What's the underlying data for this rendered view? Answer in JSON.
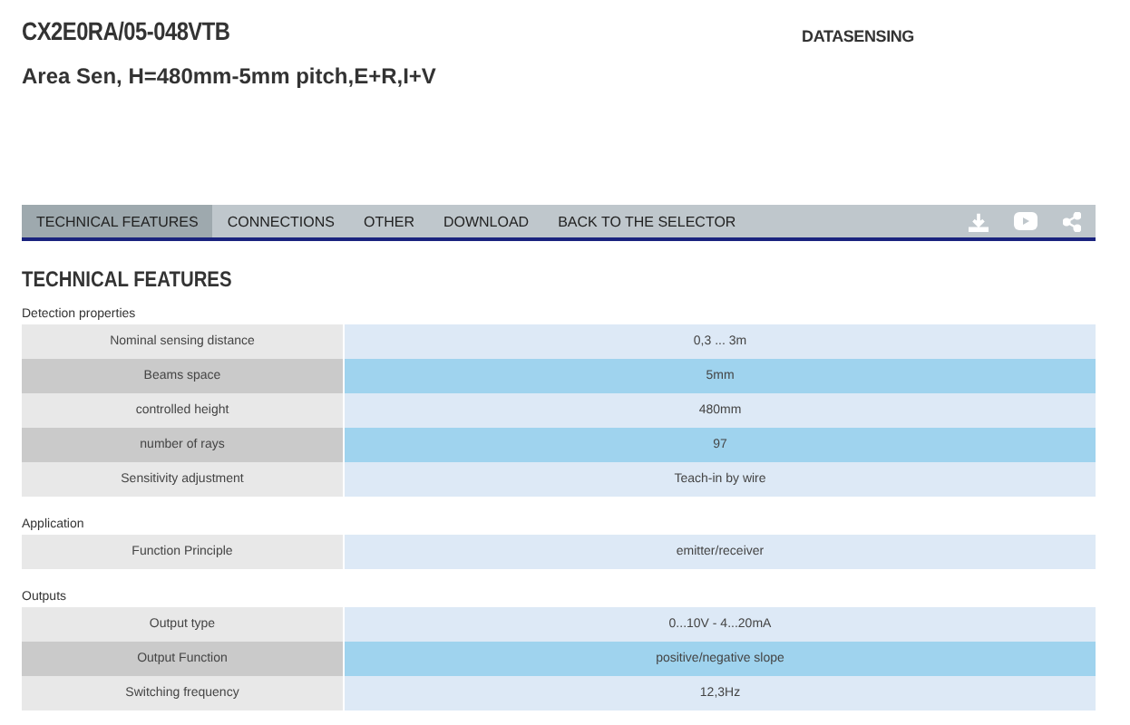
{
  "product": {
    "code": "CX2E0RA/05-048VTB",
    "description": "Area Sen, H=480mm-5mm pitch,E+R,I+V"
  },
  "logo": {
    "name": "DATASENSING"
  },
  "nav": {
    "tabs": [
      {
        "label": "TECHNICAL FEATURES",
        "selected": true
      },
      {
        "label": "CONNECTIONS",
        "selected": false
      },
      {
        "label": "OTHER",
        "selected": false
      },
      {
        "label": "DOWNLOAD",
        "selected": false
      },
      {
        "label": "BACK TO THE SELECTOR",
        "selected": false
      }
    ]
  },
  "heading": "TECHNICAL FEATURES",
  "sections": [
    {
      "title": "Detection properties",
      "rows": [
        {
          "label": "Nominal sensing distance",
          "value": "0,3 ... 3m"
        },
        {
          "label": "Beams space",
          "value": "5mm"
        },
        {
          "label": "controlled height",
          "value": "480mm"
        },
        {
          "label": "number of rays",
          "value": "97"
        },
        {
          "label": "Sensitivity adjustment",
          "value": "Teach-in by wire"
        }
      ]
    },
    {
      "title": "Application",
      "rows": [
        {
          "label": "Function Principle",
          "value": "emitter/receiver"
        }
      ]
    },
    {
      "title": "Outputs",
      "rows": [
        {
          "label": "Output type",
          "value": "0...10V - 4...20mA"
        },
        {
          "label": "Output Function",
          "value": "positive/negative slope"
        },
        {
          "label": "Switching frequency",
          "value": "12,3Hz"
        }
      ]
    }
  ]
}
